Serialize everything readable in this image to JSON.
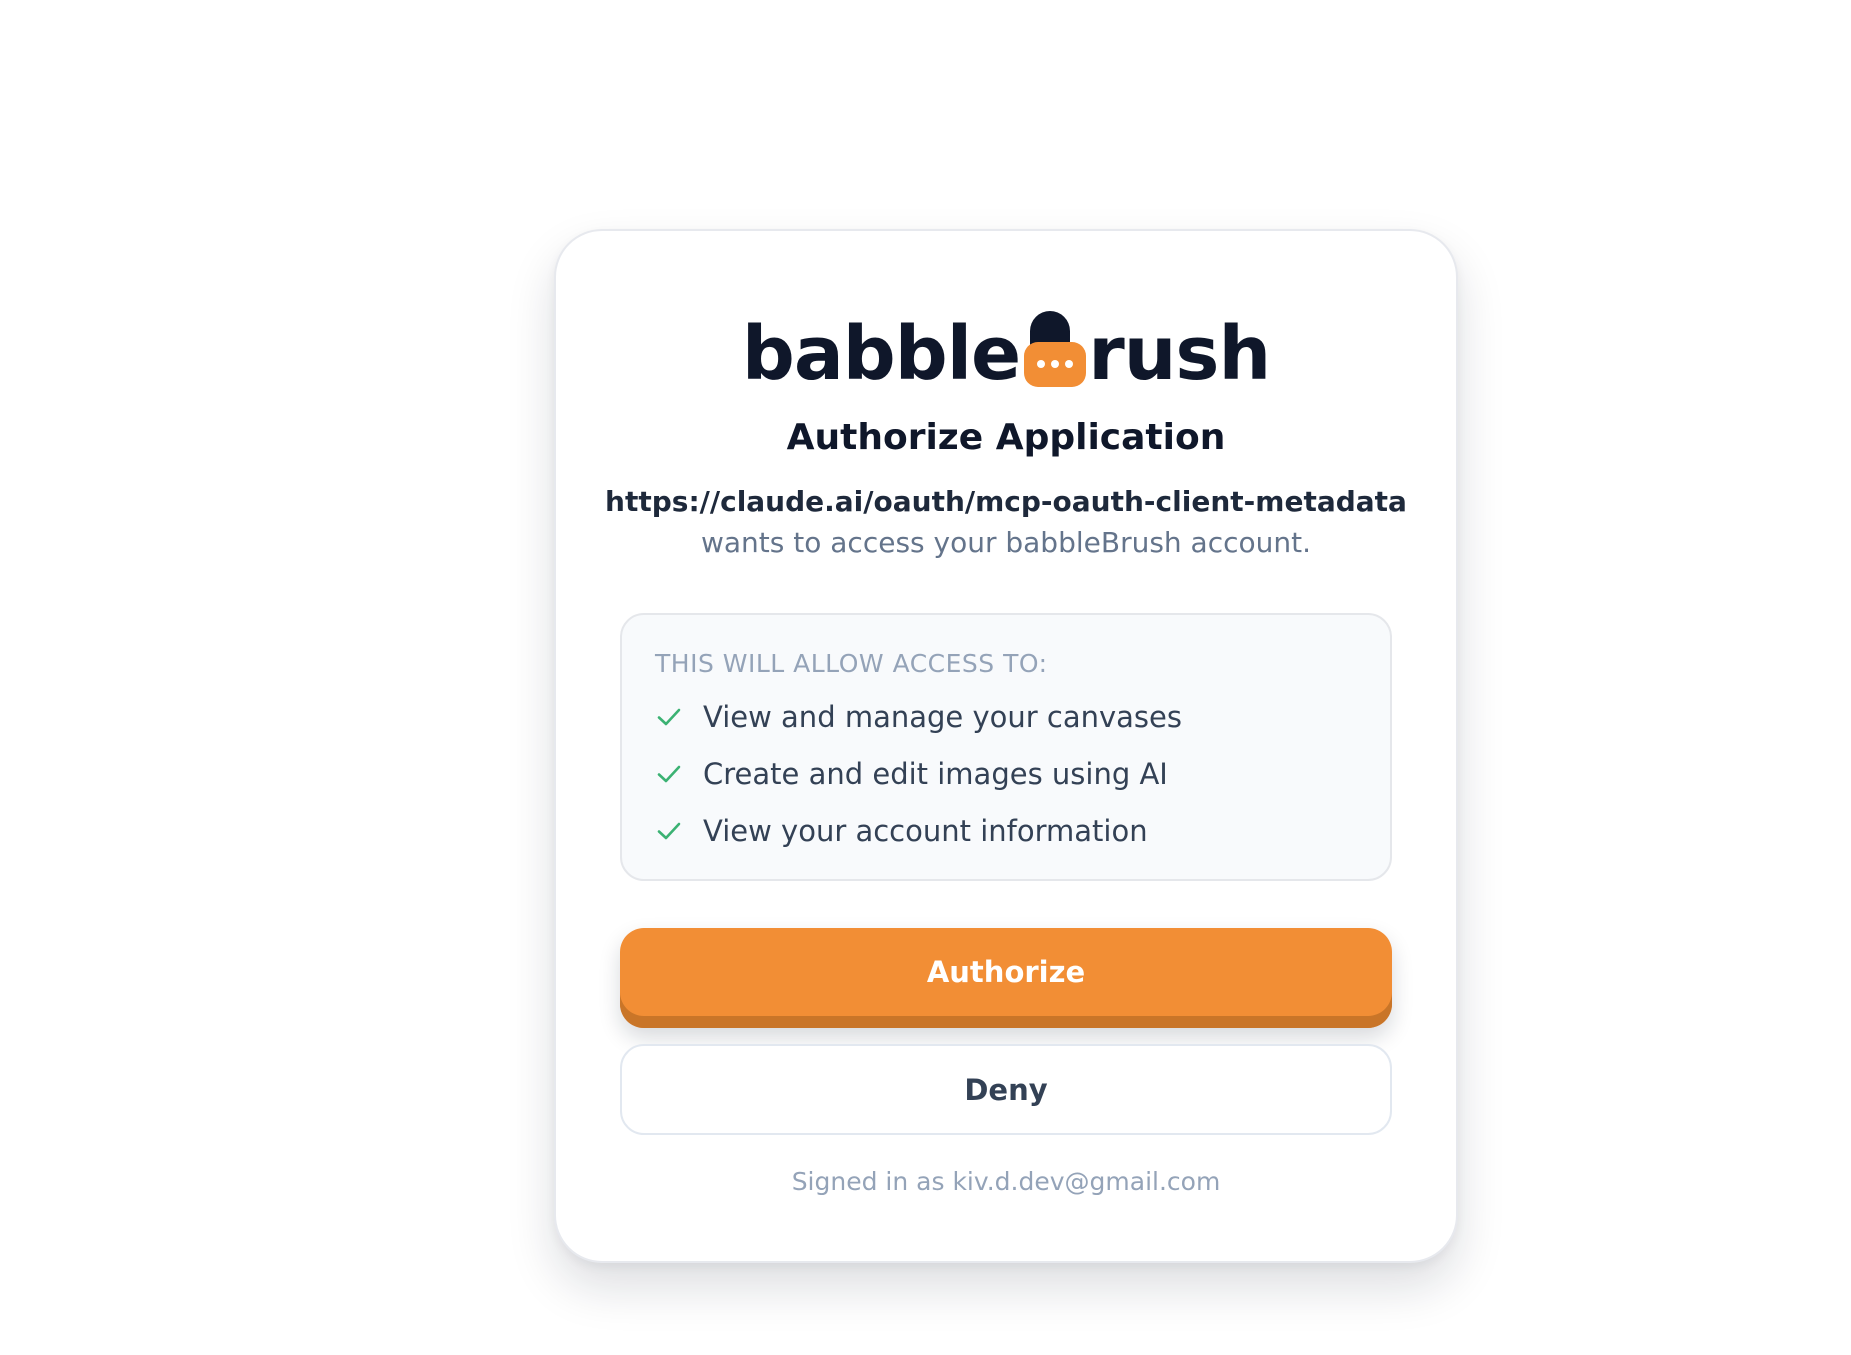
{
  "brand": {
    "name_part_1": "babble",
    "name_part_2": "rush",
    "mark_icon": "chat-bubble-b-icon",
    "primary_color": "#0f172a",
    "accent_color": "#f28e35"
  },
  "consent": {
    "title": "Authorize Application",
    "client_url": "https://claude.ai/oauth/mcp-oauth-client-metadata",
    "client_description": "wants to access your babbleBrush account."
  },
  "scopes": {
    "heading": "THIS WILL ALLOW ACCESS TO:",
    "check_icon": "check-icon",
    "check_color": "#3bb273",
    "items": [
      {
        "label": "View and manage your canvases"
      },
      {
        "label": "Create and edit images using AI"
      },
      {
        "label": "View your account information"
      }
    ]
  },
  "actions": {
    "authorize_label": "Authorize",
    "deny_label": "Deny"
  },
  "footer": {
    "signed_in_text": "Signed in as kiv.d.dev@gmail.com"
  }
}
